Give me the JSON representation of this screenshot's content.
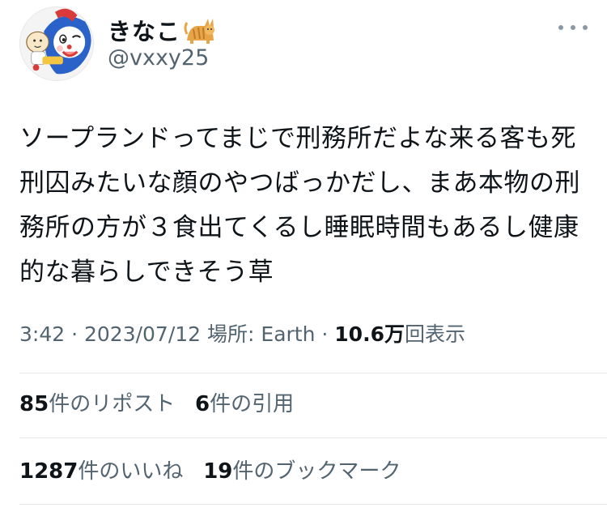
{
  "user": {
    "display_name": "きなこ",
    "handle": "@vxxy25"
  },
  "icons": {
    "avatar": "avatar-icon",
    "name_emoji": "cat-emoji-icon",
    "more": "more-options-icon"
  },
  "tweet": {
    "text": "ソープランドってまじで刑務所だよな来る客も死\n刑囚みたいな顔のやつばっかだし、まあ本物の刑\n務所の方が３食出てくるし睡眠時間もあるし健康\n的な暮らしできそう草"
  },
  "meta": {
    "time": "3:42",
    "sep1": " · ",
    "date": "2023/07/12",
    "location": " 場所: Earth",
    "sep2": " · ",
    "views_count": "10.6万",
    "views_label": "回表示"
  },
  "stats": {
    "reposts_count": "85",
    "reposts_label": "件のリポスト",
    "quotes_count": "6",
    "quotes_label": "件の引用",
    "likes_count": "1287",
    "likes_label": "件のいいね",
    "bookmarks_count": "19",
    "bookmarks_label": "件のブックマーク"
  },
  "colors": {
    "text_primary": "#0f1419",
    "text_secondary": "#536471",
    "divider": "#e6e9ec"
  }
}
